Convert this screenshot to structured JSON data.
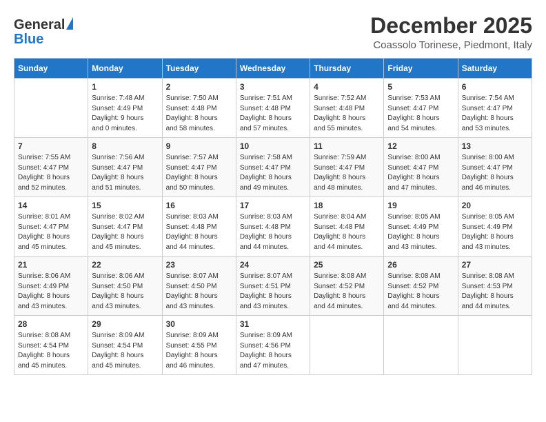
{
  "header": {
    "logo_general": "General",
    "logo_blue": "Blue",
    "month": "December 2025",
    "location": "Coassolo Torinese, Piedmont, Italy"
  },
  "weekdays": [
    "Sunday",
    "Monday",
    "Tuesday",
    "Wednesday",
    "Thursday",
    "Friday",
    "Saturday"
  ],
  "weeks": [
    [
      {
        "day": "",
        "info": ""
      },
      {
        "day": "1",
        "info": "Sunrise: 7:48 AM\nSunset: 4:49 PM\nDaylight: 9 hours\nand 0 minutes."
      },
      {
        "day": "2",
        "info": "Sunrise: 7:50 AM\nSunset: 4:48 PM\nDaylight: 8 hours\nand 58 minutes."
      },
      {
        "day": "3",
        "info": "Sunrise: 7:51 AM\nSunset: 4:48 PM\nDaylight: 8 hours\nand 57 minutes."
      },
      {
        "day": "4",
        "info": "Sunrise: 7:52 AM\nSunset: 4:48 PM\nDaylight: 8 hours\nand 55 minutes."
      },
      {
        "day": "5",
        "info": "Sunrise: 7:53 AM\nSunset: 4:47 PM\nDaylight: 8 hours\nand 54 minutes."
      },
      {
        "day": "6",
        "info": "Sunrise: 7:54 AM\nSunset: 4:47 PM\nDaylight: 8 hours\nand 53 minutes."
      }
    ],
    [
      {
        "day": "7",
        "info": "Sunrise: 7:55 AM\nSunset: 4:47 PM\nDaylight: 8 hours\nand 52 minutes."
      },
      {
        "day": "8",
        "info": "Sunrise: 7:56 AM\nSunset: 4:47 PM\nDaylight: 8 hours\nand 51 minutes."
      },
      {
        "day": "9",
        "info": "Sunrise: 7:57 AM\nSunset: 4:47 PM\nDaylight: 8 hours\nand 50 minutes."
      },
      {
        "day": "10",
        "info": "Sunrise: 7:58 AM\nSunset: 4:47 PM\nDaylight: 8 hours\nand 49 minutes."
      },
      {
        "day": "11",
        "info": "Sunrise: 7:59 AM\nSunset: 4:47 PM\nDaylight: 8 hours\nand 48 minutes."
      },
      {
        "day": "12",
        "info": "Sunrise: 8:00 AM\nSunset: 4:47 PM\nDaylight: 8 hours\nand 47 minutes."
      },
      {
        "day": "13",
        "info": "Sunrise: 8:00 AM\nSunset: 4:47 PM\nDaylight: 8 hours\nand 46 minutes."
      }
    ],
    [
      {
        "day": "14",
        "info": "Sunrise: 8:01 AM\nSunset: 4:47 PM\nDaylight: 8 hours\nand 45 minutes."
      },
      {
        "day": "15",
        "info": "Sunrise: 8:02 AM\nSunset: 4:47 PM\nDaylight: 8 hours\nand 45 minutes."
      },
      {
        "day": "16",
        "info": "Sunrise: 8:03 AM\nSunset: 4:48 PM\nDaylight: 8 hours\nand 44 minutes."
      },
      {
        "day": "17",
        "info": "Sunrise: 8:03 AM\nSunset: 4:48 PM\nDaylight: 8 hours\nand 44 minutes."
      },
      {
        "day": "18",
        "info": "Sunrise: 8:04 AM\nSunset: 4:48 PM\nDaylight: 8 hours\nand 44 minutes."
      },
      {
        "day": "19",
        "info": "Sunrise: 8:05 AM\nSunset: 4:49 PM\nDaylight: 8 hours\nand 43 minutes."
      },
      {
        "day": "20",
        "info": "Sunrise: 8:05 AM\nSunset: 4:49 PM\nDaylight: 8 hours\nand 43 minutes."
      }
    ],
    [
      {
        "day": "21",
        "info": "Sunrise: 8:06 AM\nSunset: 4:49 PM\nDaylight: 8 hours\nand 43 minutes."
      },
      {
        "day": "22",
        "info": "Sunrise: 8:06 AM\nSunset: 4:50 PM\nDaylight: 8 hours\nand 43 minutes."
      },
      {
        "day": "23",
        "info": "Sunrise: 8:07 AM\nSunset: 4:50 PM\nDaylight: 8 hours\nand 43 minutes."
      },
      {
        "day": "24",
        "info": "Sunrise: 8:07 AM\nSunset: 4:51 PM\nDaylight: 8 hours\nand 43 minutes."
      },
      {
        "day": "25",
        "info": "Sunrise: 8:08 AM\nSunset: 4:52 PM\nDaylight: 8 hours\nand 44 minutes."
      },
      {
        "day": "26",
        "info": "Sunrise: 8:08 AM\nSunset: 4:52 PM\nDaylight: 8 hours\nand 44 minutes."
      },
      {
        "day": "27",
        "info": "Sunrise: 8:08 AM\nSunset: 4:53 PM\nDaylight: 8 hours\nand 44 minutes."
      }
    ],
    [
      {
        "day": "28",
        "info": "Sunrise: 8:08 AM\nSunset: 4:54 PM\nDaylight: 8 hours\nand 45 minutes."
      },
      {
        "day": "29",
        "info": "Sunrise: 8:09 AM\nSunset: 4:54 PM\nDaylight: 8 hours\nand 45 minutes."
      },
      {
        "day": "30",
        "info": "Sunrise: 8:09 AM\nSunset: 4:55 PM\nDaylight: 8 hours\nand 46 minutes."
      },
      {
        "day": "31",
        "info": "Sunrise: 8:09 AM\nSunset: 4:56 PM\nDaylight: 8 hours\nand 47 minutes."
      },
      {
        "day": "",
        "info": ""
      },
      {
        "day": "",
        "info": ""
      },
      {
        "day": "",
        "info": ""
      }
    ]
  ]
}
